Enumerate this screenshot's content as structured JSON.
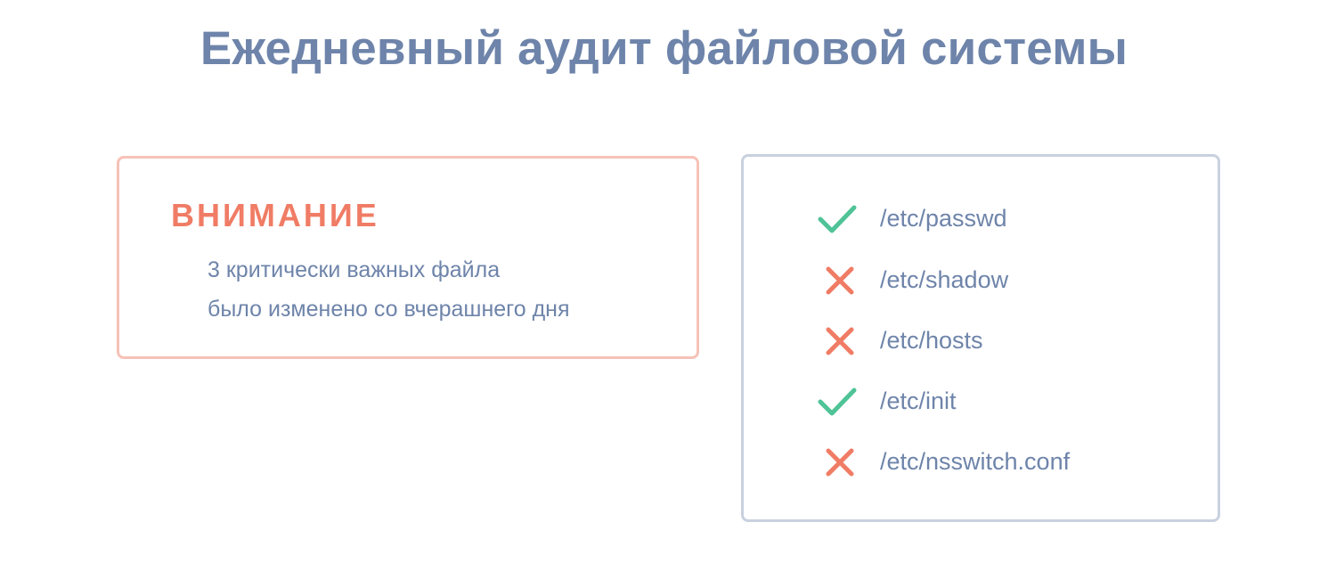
{
  "title": "Ежедневный аудит файловой системы",
  "warning": {
    "heading": "ВНИМАНИЕ",
    "line1": "3 критически важных файла",
    "line2": "было изменено со вчерашнего дня"
  },
  "files": [
    {
      "name": "/etc/passwd",
      "status": "ok",
      "icon": "check-icon"
    },
    {
      "name": "/etc/shadow",
      "status": "changed",
      "icon": "cross-icon"
    },
    {
      "name": "/etc/hosts",
      "status": "changed",
      "icon": "cross-icon"
    },
    {
      "name": "/etc/init",
      "status": "ok",
      "icon": "check-icon"
    },
    {
      "name": "/etc/nsswitch.conf",
      "status": "changed",
      "icon": "cross-icon"
    }
  ],
  "colors": {
    "title": "#6e84aa",
    "warning_accent": "#f07c65",
    "warning_border": "#f7c2b7",
    "panel_border": "#c9d1df",
    "ok": "#4fc397",
    "changed": "#f07c65"
  }
}
